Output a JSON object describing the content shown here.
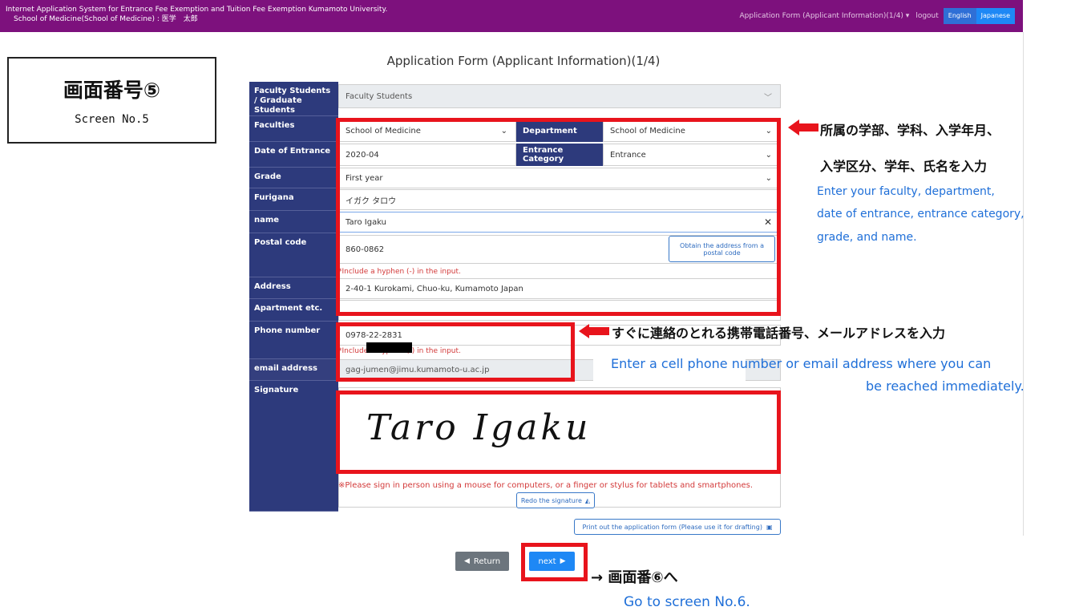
{
  "navbar": {
    "title_line1": "Internet Application System for Entrance Fee Exemption and Tuition Fee Exemption Kumamoto University.",
    "title_line2": "School of Medicine(School of Medicine) : 医学　太郎",
    "menu": "Application Form (Applicant Information)(1/4) ▾",
    "logout": "logout",
    "lang_en": "English",
    "lang_jp": "Japanese"
  },
  "screen_label": {
    "jp": "画面番号⑤",
    "en": "Screen No.5"
  },
  "page_title": "Application Form (Applicant Information)(1/4)",
  "form": {
    "faculty_students_label": "Faculty Students / Graduate Students",
    "faculty_students_value": "Faculty Students",
    "faculties_label": "Faculties",
    "faculties_value": "School of Medicine",
    "department_label": "Department",
    "department_value": "School of Medicine",
    "date_label": "Date of Entrance",
    "date_value": "2020-04",
    "category_label": "Entrance Category",
    "category_value": "Entrance",
    "grade_label": "Grade",
    "grade_value": "First year",
    "furigana_label": "Furigana",
    "furigana_value": "イガク タロウ",
    "name_label": "name",
    "name_value": "Taro Igaku",
    "postal_label": "Postal code",
    "postal_value": "860-0862",
    "postal_button": "Obtain the address from a postal code",
    "postal_note": "*Include a hyphen (-) in the input.",
    "address_label": "Address",
    "address_value": "2-40-1 Kurokami, Chuo-ku, Kumamoto Japan",
    "apartment_label": "Apartment etc.",
    "apartment_value": "",
    "phone_label": "Phone number",
    "phone_value": "0978-22-2831",
    "phone_note": "*Include a hyphen (-) in the input.",
    "email_label": "email address",
    "email_value": "gag-jumen@jimu.kumamoto-u.ac.jp",
    "signature_label": "Signature",
    "signature_value": "Taro Igaku",
    "signature_note": "※Please sign in person using a mouse for computers, or a finger or stylus for tablets and smartphones.",
    "redo_button": "Redo the signature",
    "print_button": "Print out the application form (Please use it for drafting)",
    "return_button": "Return",
    "next_button": "next"
  },
  "annotations": {
    "a1_jp_line1": "所属の学部、学科、入学年月、",
    "a1_jp_line2": "入学区分、学年、氏名を入力",
    "a1_en_line1": "Enter your faculty, department,",
    "a1_en_line2": "date of entrance, entrance category,",
    "a1_en_line3": "grade, and name.",
    "a2_jp": "すぐに連絡のとれる携帯電話番号、メールアドレスを入力",
    "a2_en_line1": "Enter a cell phone number or email address where you can",
    "a2_en_line2": "be reached immediately.",
    "a3_jp": "→ 画面番⑥へ",
    "a3_en": "Go to screen No.6."
  },
  "colors": {
    "nav_bg": "#7d117d",
    "label_bg": "#2d3a7c",
    "highlight": "#e8141c",
    "annotation_en": "#1f6fd8"
  }
}
